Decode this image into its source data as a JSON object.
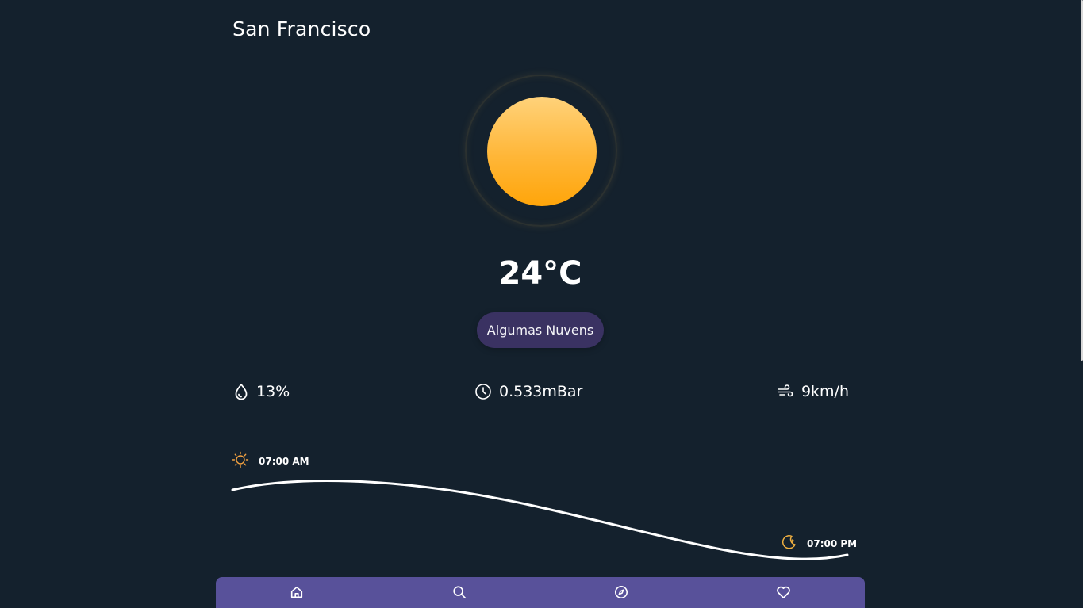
{
  "location": {
    "city": "San Francisco"
  },
  "weather": {
    "temperature": "24°C",
    "description": "Algumas Nuvens",
    "icon": "sun-icon"
  },
  "stats": {
    "humidity": {
      "value": "13%",
      "icon": "droplet-icon"
    },
    "pressure": {
      "value": "0.533mBar",
      "icon": "gauge-clock-icon"
    },
    "wind": {
      "value": "9km/h",
      "icon": "wind-icon"
    }
  },
  "sun_cycle": {
    "sunrise": "07:00 AM",
    "sunset": "07:00 PM",
    "sunrise_icon": "sunrise-sun-icon",
    "sunset_icon": "moon-icon"
  },
  "nav": {
    "items": [
      {
        "icon": "home-icon"
      },
      {
        "icon": "search-icon"
      },
      {
        "icon": "compass-icon"
      },
      {
        "icon": "heart-icon"
      }
    ]
  },
  "colors": {
    "background": "#14212d",
    "accent": "#58519a",
    "pill": "#3a3262",
    "sun": "#ffb637",
    "sun_icon": "#f0a040"
  }
}
